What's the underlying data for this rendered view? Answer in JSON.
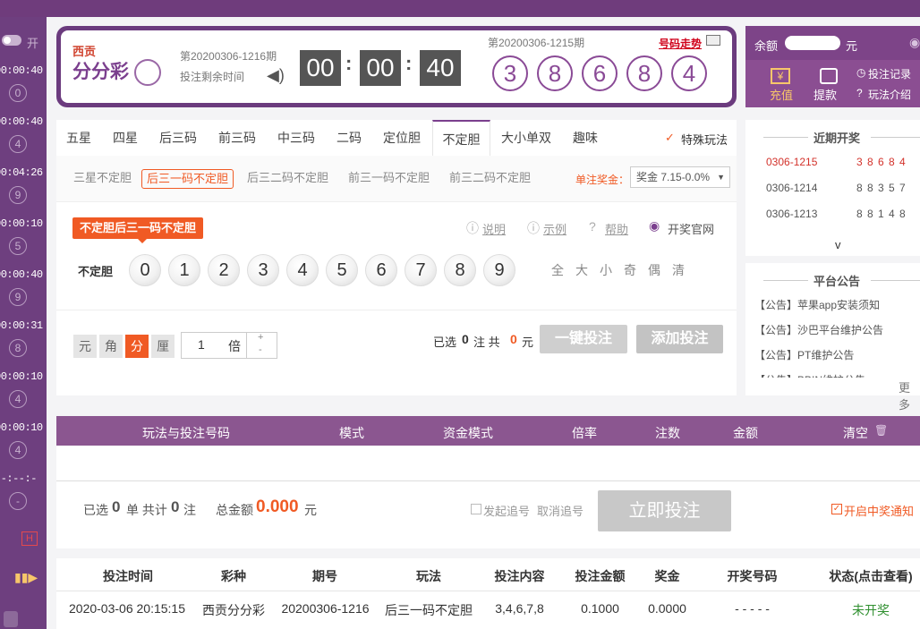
{
  "left": {
    "toggle_label": "开",
    "rows": [
      {
        "time": "00:00:40",
        "ball": "0"
      },
      {
        "time": "00:00:40",
        "ball": "4"
      },
      {
        "time": "00:04:26",
        "ball": "9"
      },
      {
        "time": "00:00:10",
        "ball": "5"
      },
      {
        "time": "00:00:40",
        "ball": "9"
      },
      {
        "time": "00:00:31",
        "ball": "8"
      },
      {
        "time": "00:00:10",
        "ball": "4"
      },
      {
        "time": "00:00:10",
        "ball": "4"
      },
      {
        "time": "--:--:--",
        "ball": "-"
      }
    ],
    "hot_badge": "H"
  },
  "lottery": {
    "brand_line1": "西贡",
    "brand_line2": "分分彩",
    "current_issue": "第20200306-1216期",
    "countdown_label": "投注剩余时间",
    "countdown": [
      "00",
      "00",
      "40"
    ],
    "last_issue": "第20200306-1215期",
    "trend_link": "号码走势",
    "last_numbers": [
      "3",
      "8",
      "6",
      "8",
      "4"
    ]
  },
  "account": {
    "balance_label": "余额",
    "balance_unit": "元",
    "recharge": "充值",
    "withdraw": "提款",
    "bet_record": "投注记录",
    "play_intro": "玩法介绍"
  },
  "tabs": [
    "五星",
    "四星",
    "后三码",
    "前三码",
    "中三码",
    "二码",
    "定位胆",
    "不定胆",
    "大小单双",
    "趣味"
  ],
  "special_play": "特殊玩法",
  "subtabs": [
    "三星不定胆",
    "后三一码不定胆",
    "后三二码不定胆",
    "前三一码不定胆",
    "前三二码不定胆"
  ],
  "prize_label": "单注奖金：",
  "prize_value": "奖金 7.15-0.0%",
  "play_title": "不定胆后三一码不定胆",
  "links": {
    "explain": "说明",
    "example": "示例",
    "help": "帮助",
    "official": "开奖官网"
  },
  "row_label": "不定胆",
  "numbers": [
    "0",
    "1",
    "2",
    "3",
    "4",
    "5",
    "6",
    "7",
    "8",
    "9"
  ],
  "quick_select": [
    "全",
    "大",
    "小",
    "奇",
    "偶",
    "清"
  ],
  "units": [
    "元",
    "角",
    "分",
    "厘"
  ],
  "multiplier": {
    "value": "1",
    "unit": "倍",
    "plus": "+",
    "minus": "-"
  },
  "selection": {
    "prefix": "已选",
    "count": "0",
    "mid": "注 共",
    "amount": "0",
    "suffix": "元"
  },
  "buttons": {
    "one_click": "一键投注",
    "add": "添加投注",
    "submit": "立即投注"
  },
  "recent": {
    "title": "近期开奖",
    "rows": [
      {
        "issue": "0306-1215",
        "nums": "3 8 6 8 4"
      },
      {
        "issue": "0306-1214",
        "nums": "8 8 3 5 7"
      },
      {
        "issue": "0306-1213",
        "nums": "8 8 1 4 8"
      }
    ],
    "more_arrow": "v"
  },
  "notice": {
    "title": "平台公告",
    "items": [
      "【公告】苹果app安装须知",
      "【公告】沙巴平台维护公告",
      "【公告】PT维护公告",
      "【公告】BBIN维护公告"
    ],
    "more": "更多"
  },
  "order_table": {
    "headers": [
      "玩法与投注号码",
      "模式",
      "资金模式",
      "倍率",
      "注数",
      "金额",
      "清空"
    ]
  },
  "summary": {
    "selected_prefix": "已选",
    "selected_count": "0",
    "unit_dan": "单 共计",
    "total_count": "0",
    "unit_zhu": "注",
    "total_label": "总金额",
    "total_value": "0.000",
    "total_unit": "元",
    "chase": "发起追号",
    "cancel_chase": "取消追号",
    "notify": "开启中奖通知"
  },
  "history": {
    "headers": [
      "投注时间",
      "彩种",
      "期号",
      "玩法",
      "投注内容",
      "投注金额",
      "奖金",
      "开奖号码",
      "状态(点击查看)"
    ],
    "row": [
      "2020-03-06 20:15:15",
      "西贡分分彩",
      "20200306-1216",
      "后三一码不定胆",
      "3,4,6,7,8",
      "0.1000",
      "0.0000",
      "- - - - -",
      "未开奖"
    ]
  },
  "colors": {
    "purple": "#6b3b7e",
    "accent_orange": "#f05a24",
    "red": "#d3322b",
    "gray_button": "#c8c8c8",
    "green_status": "#2f8f2f"
  }
}
